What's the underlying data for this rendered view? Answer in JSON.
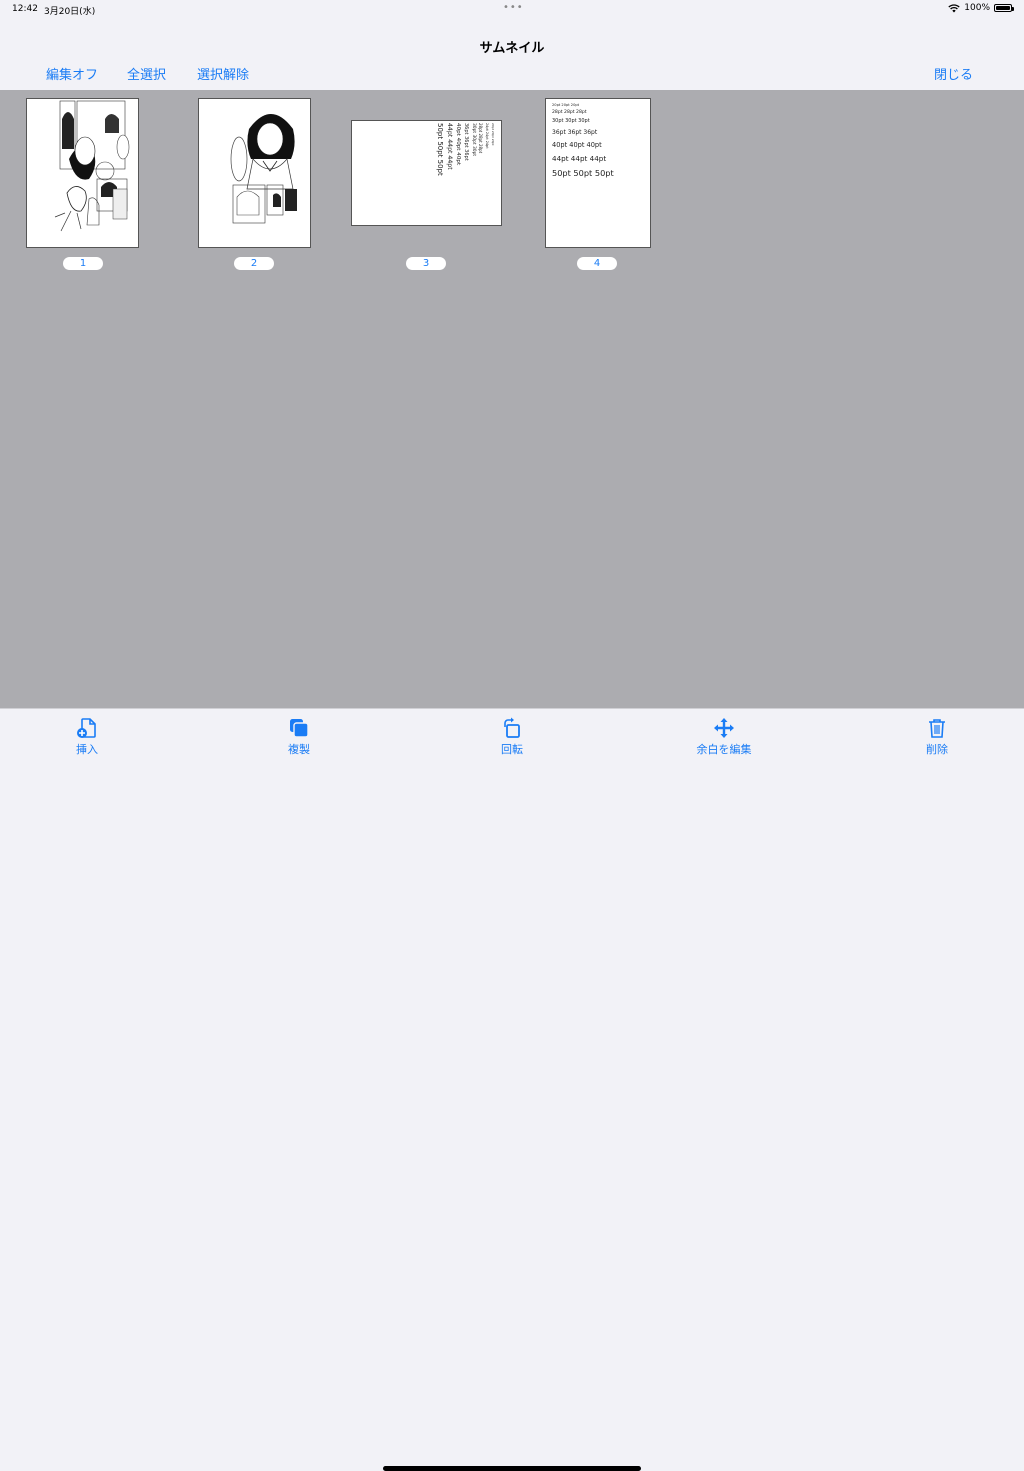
{
  "status": {
    "time": "12:42",
    "date": "3月20日(水)",
    "dots": "•••",
    "battery_percent": "100%",
    "battery_level": 1.0
  },
  "nav": {
    "title": "サムネイル",
    "edit_off": "編集オフ",
    "select_all": "全選択",
    "deselect": "選択解除",
    "close": "閉じる"
  },
  "pages": [
    {
      "number": "1"
    },
    {
      "number": "2"
    },
    {
      "number": "3",
      "text_lines": [
        "20pt 20pt 20pt",
        "24pt 24pt 24pt",
        "28pt 28pt 28pt",
        "30pt 30pt 30pt",
        "36pt 36pt 36pt",
        "40pt 40pt 40pt",
        "44pt 44pt 44pt",
        "50pt 50pt 50pt"
      ]
    },
    {
      "number": "4",
      "text_lines": [
        "20pt 20pt 20pt",
        "28pt 28pt 28pt",
        "30pt 30pt 30pt",
        "36pt 36pt 36pt",
        "40pt 40pt 40pt",
        "44pt 44pt 44pt",
        "50pt 50pt 50pt"
      ]
    }
  ],
  "toolbar": {
    "insert": "挿入",
    "duplicate": "複製",
    "rotate": "回転",
    "edit_margin": "余白を編集",
    "delete": "削除"
  },
  "colors": {
    "accent": "#1a7cf5",
    "canvas": "#acacb0",
    "bar": "#f2f2f7"
  }
}
